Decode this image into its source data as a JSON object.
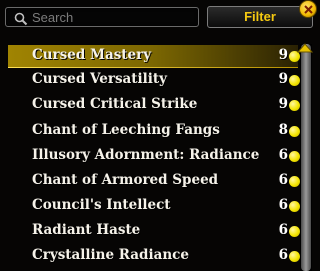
{
  "search": {
    "placeholder": "Search",
    "value": ""
  },
  "filter_label": "Filter",
  "items": [
    {
      "name": "Cursed Mastery",
      "count": "9",
      "selected": true
    },
    {
      "name": "Cursed Versatility",
      "count": "9"
    },
    {
      "name": "Cursed Critical Strike",
      "count": "9"
    },
    {
      "name": "Chant of Leeching Fangs",
      "count": "8"
    },
    {
      "name": "Illusory Adornment: Radiance",
      "count": "6"
    },
    {
      "name": "Chant of Armored Speed",
      "count": "6"
    },
    {
      "name": "Council's Intellect",
      "count": "6"
    },
    {
      "name": "Radiant Haste",
      "count": "6"
    },
    {
      "name": "Crystalline Radiance",
      "count": "6"
    }
  ],
  "colors": {
    "accent": "#f5c911",
    "dot": "#f3e400",
    "selected": "#ffd200"
  },
  "icons": {
    "search": "search-icon",
    "close": "close-icon",
    "scroll_up": "scroll-up-arrow-icon"
  }
}
